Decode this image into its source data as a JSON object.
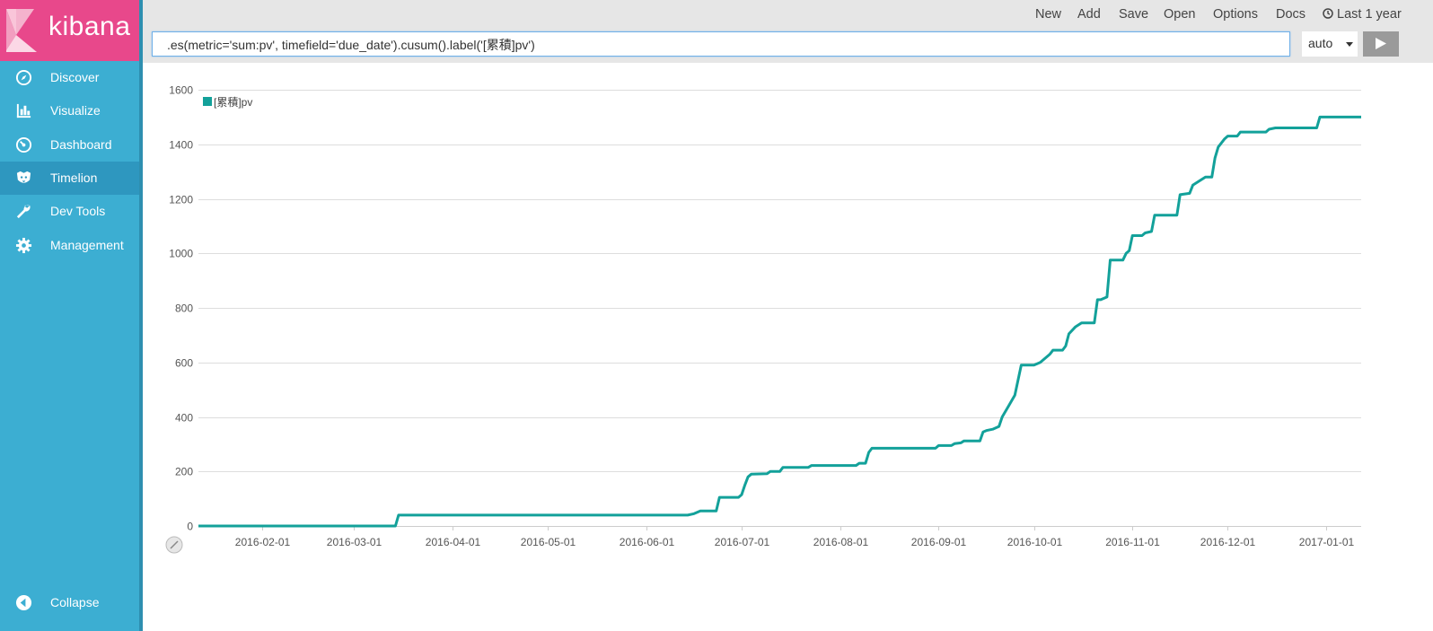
{
  "app": {
    "brand": "kibana",
    "brand_color": "#e8488b",
    "sidebar_color": "#3caed2",
    "accent_line_color": "#13a19a"
  },
  "sidebar": {
    "items": [
      {
        "label": "Discover",
        "icon": "compass-icon",
        "active": false
      },
      {
        "label": "Visualize",
        "icon": "bar-chart-icon",
        "active": false
      },
      {
        "label": "Dashboard",
        "icon": "gauge-icon",
        "active": false
      },
      {
        "label": "Timelion",
        "icon": "timelion-icon",
        "active": true
      },
      {
        "label": "Dev Tools",
        "icon": "wrench-icon",
        "active": false
      },
      {
        "label": "Management",
        "icon": "gear-icon",
        "active": false
      }
    ],
    "collapse_label": "Collapse"
  },
  "topbar": {
    "menu": [
      "New",
      "Add",
      "Save",
      "Open",
      "Options",
      "Docs"
    ],
    "time_label": "Last 1 year",
    "time_icon": "clock-icon"
  },
  "query": {
    "expression": ".es(metric='sum:pv', timefield='due_date').cusum().label('[累積]pv')",
    "interval": "auto",
    "run_icon": "play-icon"
  },
  "chart_data": {
    "type": "line",
    "title": "",
    "xlabel": "",
    "ylabel": "",
    "ylim": [
      0,
      1600
    ],
    "y_ticks": [
      0,
      200,
      400,
      600,
      800,
      1000,
      1200,
      1400,
      1600
    ],
    "x_ticks": [
      "2016-02-01",
      "2016-03-01",
      "2016-04-01",
      "2016-05-01",
      "2016-06-01",
      "2016-07-01",
      "2016-08-01",
      "2016-09-01",
      "2016-10-01",
      "2016-11-01",
      "2016-12-01",
      "2017-01-01"
    ],
    "xlim": [
      "2016-01-12",
      "2017-01-12"
    ],
    "grid": true,
    "legend_position": "top-left",
    "series": [
      {
        "name": "[累積]pv",
        "color": "#13a19a",
        "points": [
          [
            "2016-01-12",
            0
          ],
          [
            "2016-03-14",
            0
          ],
          [
            "2016-03-15",
            40
          ],
          [
            "2016-06-14",
            40
          ],
          [
            "2016-06-16",
            45
          ],
          [
            "2016-06-18",
            55
          ],
          [
            "2016-06-23",
            55
          ],
          [
            "2016-06-24",
            105
          ],
          [
            "2016-06-30",
            105
          ],
          [
            "2016-07-01",
            115
          ],
          [
            "2016-07-02",
            150
          ],
          [
            "2016-07-03",
            180
          ],
          [
            "2016-07-04",
            190
          ],
          [
            "2016-07-09",
            192
          ],
          [
            "2016-07-10",
            200
          ],
          [
            "2016-07-13",
            200
          ],
          [
            "2016-07-14",
            215
          ],
          [
            "2016-07-22",
            215
          ],
          [
            "2016-07-23",
            222
          ],
          [
            "2016-08-06",
            222
          ],
          [
            "2016-08-07",
            230
          ],
          [
            "2016-08-09",
            230
          ],
          [
            "2016-08-10",
            270
          ],
          [
            "2016-08-11",
            285
          ],
          [
            "2016-08-31",
            285
          ],
          [
            "2016-09-01",
            295
          ],
          [
            "2016-09-05",
            295
          ],
          [
            "2016-09-06",
            302
          ],
          [
            "2016-09-08",
            305
          ],
          [
            "2016-09-09",
            312
          ],
          [
            "2016-09-14",
            312
          ],
          [
            "2016-09-15",
            345
          ],
          [
            "2016-09-16",
            350
          ],
          [
            "2016-09-18",
            355
          ],
          [
            "2016-09-20",
            365
          ],
          [
            "2016-09-21",
            400
          ],
          [
            "2016-09-23",
            440
          ],
          [
            "2016-09-25",
            480
          ],
          [
            "2016-09-27",
            590
          ],
          [
            "2016-10-01",
            590
          ],
          [
            "2016-10-03",
            600
          ],
          [
            "2016-10-06",
            630
          ],
          [
            "2016-10-07",
            645
          ],
          [
            "2016-10-10",
            645
          ],
          [
            "2016-10-11",
            660
          ],
          [
            "2016-10-12",
            705
          ],
          [
            "2016-10-14",
            730
          ],
          [
            "2016-10-16",
            745
          ],
          [
            "2016-10-20",
            745
          ],
          [
            "2016-10-21",
            830
          ],
          [
            "2016-10-22",
            830
          ],
          [
            "2016-10-24",
            840
          ],
          [
            "2016-10-25",
            975
          ],
          [
            "2016-10-29",
            975
          ],
          [
            "2016-10-30",
            1000
          ],
          [
            "2016-10-31",
            1010
          ],
          [
            "2016-11-01",
            1065
          ],
          [
            "2016-11-04",
            1065
          ],
          [
            "2016-11-05",
            1075
          ],
          [
            "2016-11-07",
            1080
          ],
          [
            "2016-11-08",
            1140
          ],
          [
            "2016-11-15",
            1140
          ],
          [
            "2016-11-16",
            1215
          ],
          [
            "2016-11-19",
            1220
          ],
          [
            "2016-11-20",
            1250
          ],
          [
            "2016-11-22",
            1265
          ],
          [
            "2016-11-24",
            1280
          ],
          [
            "2016-11-26",
            1280
          ],
          [
            "2016-11-27",
            1350
          ],
          [
            "2016-11-28",
            1390
          ],
          [
            "2016-11-30",
            1420
          ],
          [
            "2016-12-01",
            1430
          ],
          [
            "2016-12-04",
            1430
          ],
          [
            "2016-12-05",
            1445
          ],
          [
            "2016-12-13",
            1445
          ],
          [
            "2016-12-14",
            1455
          ],
          [
            "2016-12-16",
            1460
          ],
          [
            "2016-12-29",
            1460
          ],
          [
            "2016-12-30",
            1500
          ],
          [
            "2017-01-12",
            1500
          ]
        ]
      }
    ]
  }
}
